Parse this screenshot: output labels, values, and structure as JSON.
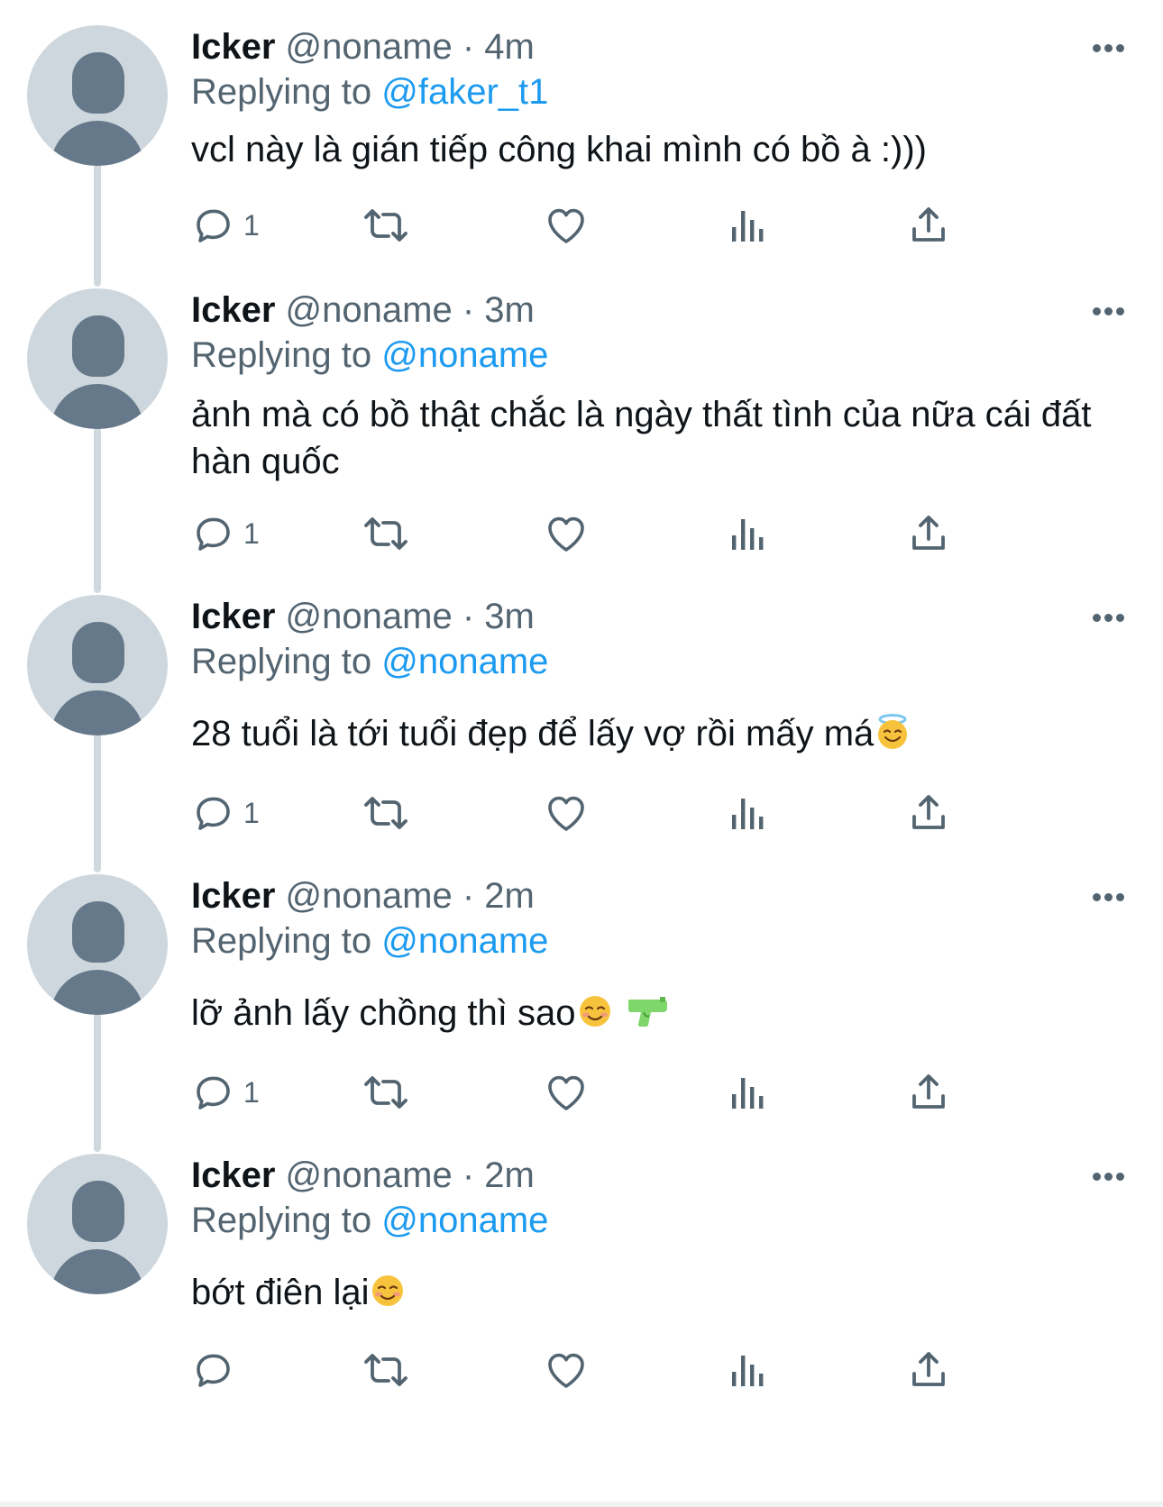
{
  "colors": {
    "accent": "#1d9bf0",
    "secondary_text": "#536471",
    "primary_text": "#0f1419",
    "avatar_bg": "#cdd7dd",
    "avatar_fg": "#66798a"
  },
  "icons": {
    "reply": "speech-bubble-icon",
    "retweet": "retweet-icon",
    "like": "heart-icon",
    "views": "bar-chart-icon",
    "share": "share-icon",
    "more": "more-dots-icon"
  },
  "tweets": [
    {
      "name": "Icker",
      "handle": "@noname",
      "sep": "·",
      "time": "4m",
      "replying_prefix": "Replying to",
      "replying_to": "@faker_t1",
      "text": "vcl này là gián tiếp công khai mình có bồ à :)))",
      "emoji": "",
      "reply_count": "1"
    },
    {
      "name": "Icker",
      "handle": "@noname",
      "sep": "·",
      "time": "3m",
      "replying_prefix": "Replying to",
      "replying_to": "@noname",
      "text": "ảnh mà có bồ thật chắc là ngày thất tình của nữa cái đất hàn quốc",
      "emoji": "",
      "reply_count": "1"
    },
    {
      "name": "Icker",
      "handle": "@noname",
      "sep": "·",
      "time": "3m",
      "replying_prefix": "Replying to",
      "replying_to": "@noname",
      "text": "28 tuổi là tới tuổi đẹp để lấy vợ rồi mấy má",
      "emoji": "smiling-face-with-halo",
      "reply_count": "1"
    },
    {
      "name": "Icker",
      "handle": "@noname",
      "sep": "·",
      "time": "2m",
      "replying_prefix": "Replying to",
      "replying_to": "@noname",
      "text": "lỡ ảnh lấy chồng thì sao",
      "emoji": "smiling-face + water-pistol",
      "reply_count": "1"
    },
    {
      "name": "Icker",
      "handle": "@noname",
      "sep": "·",
      "time": "2m",
      "replying_prefix": "Replying to",
      "replying_to": "@noname",
      "text": "bớt điên lại",
      "emoji": "smiling-face",
      "reply_count": ""
    }
  ]
}
